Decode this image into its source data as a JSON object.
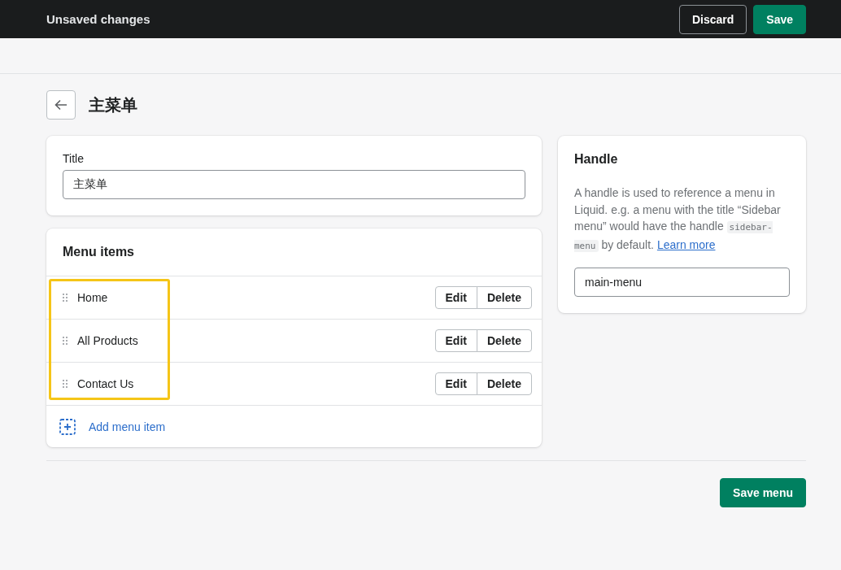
{
  "top_bar": {
    "title": "Unsaved changes",
    "buttons": [
      {
        "label": "Discard",
        "kind": "secondary"
      },
      {
        "label": "Save",
        "kind": "primary"
      }
    ]
  },
  "page": {
    "title": "主菜单"
  },
  "title_card": {
    "label": "Title",
    "value": "主菜单"
  },
  "menu_card": {
    "title": "Menu items",
    "names_highlighted": true,
    "items": [
      {
        "name": "Home",
        "actions": [
          "Edit",
          "Delete"
        ]
      },
      {
        "name": "All Products",
        "actions": [
          "Edit",
          "Delete"
        ]
      },
      {
        "name": "Contact Us",
        "actions": [
          "Edit",
          "Delete"
        ]
      }
    ],
    "add_label": "Add menu item"
  },
  "handle_card": {
    "title": "Handle",
    "description": [
      {
        "kind": "text",
        "text": "A handle is used to reference a menu in Liquid. e.g. a menu with the title “Sidebar menu” would have the handle "
      },
      {
        "kind": "code",
        "text": "sidebar-menu"
      },
      {
        "kind": "text",
        "text": " by default. "
      },
      {
        "kind": "link",
        "text": "Learn more"
      }
    ],
    "value": "main-menu"
  },
  "footer": {
    "button": "Save menu"
  }
}
